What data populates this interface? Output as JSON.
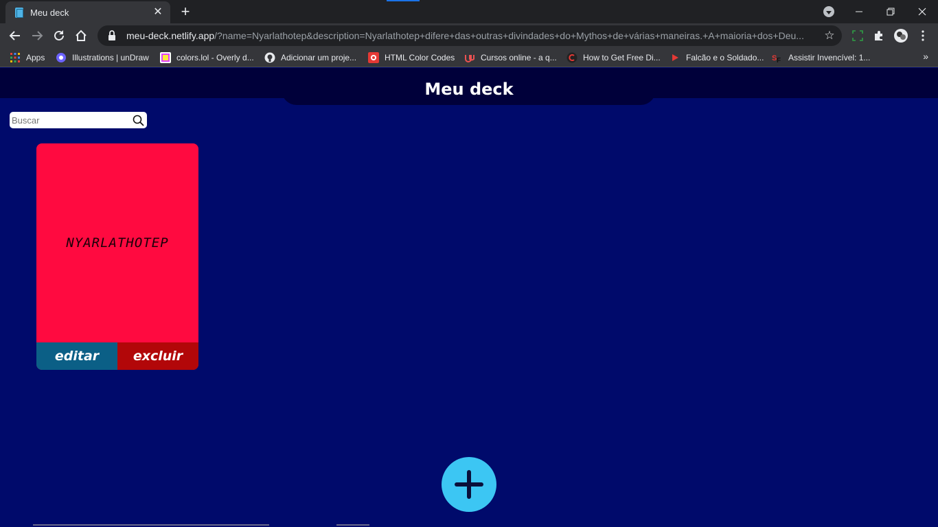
{
  "browser": {
    "tab_title": "Meu deck",
    "tab_close": "✕",
    "new_tab": "+",
    "url_host": "meu-deck.netlify.app",
    "url_rest": "/?name=Nyarlathotep&description=Nyarlathotep+difere+das+outras+divindades+do+Mythos+de+várias+maneiras.+A+maioria+dos+Deu...",
    "window_controls": {
      "minimize": "—",
      "restore": "❐",
      "close": "✕"
    }
  },
  "bookmarks": [
    {
      "label": "Apps",
      "icon": "apps-grid-icon"
    },
    {
      "label": "Illustrations | unDraw",
      "icon": "undraw-icon"
    },
    {
      "label": "colors.lol - Overly d...",
      "icon": "colors-lol-icon"
    },
    {
      "label": "Adicionar um proje...",
      "icon": "github-icon"
    },
    {
      "label": "HTML Color Codes",
      "icon": "html-color-codes-icon"
    },
    {
      "label": "Cursos online - a q...",
      "icon": "udemy-icon"
    },
    {
      "label": "How to Get Free Di...",
      "icon": "c-logo-icon"
    },
    {
      "label": "Falcão e o Soldado...",
      "icon": "play-icon"
    },
    {
      "label": "Assistir Invencível: 1...",
      "icon": "sf-logo-icon"
    }
  ],
  "bookmarks_more": "»",
  "page": {
    "title": "Meu deck",
    "search_placeholder": "Buscar",
    "cards": [
      {
        "name": "NYARLATHOTEP",
        "color": "#ff0a40",
        "edit_label": "editar",
        "delete_label": "excluir"
      }
    ],
    "add_button_icon": "plus-icon"
  },
  "colors": {
    "page_bg": "#000a6b",
    "header_bg": "#00003a",
    "edit_btn": "#0b5f86",
    "delete_btn": "#b20709",
    "fab": "#3cc6f3"
  }
}
